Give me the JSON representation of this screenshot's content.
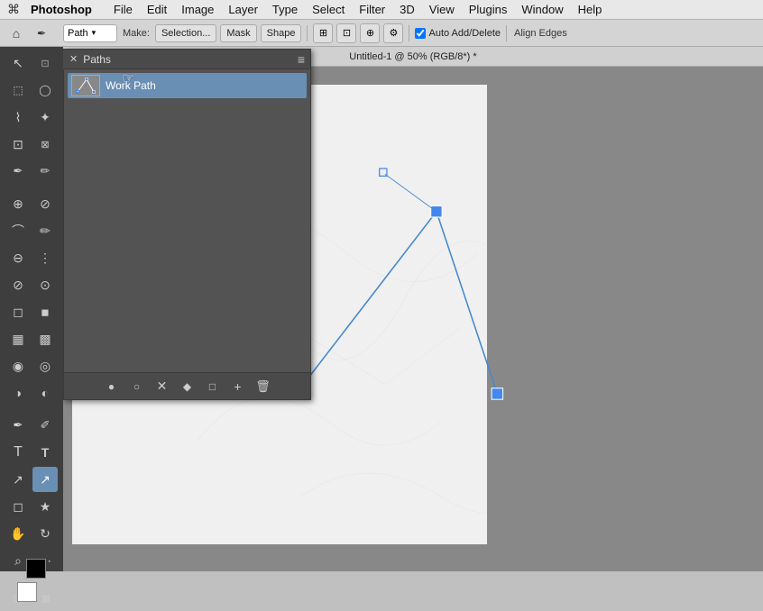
{
  "menubar": {
    "apple": "⌘",
    "appname": "Photoshop",
    "items": [
      "File",
      "Edit",
      "Image",
      "Layer",
      "Type",
      "Select",
      "Filter",
      "3D",
      "View",
      "Plugins",
      "Window",
      "Help"
    ]
  },
  "optionsbar": {
    "tool_icon": "pen",
    "path_dropdown": "Path",
    "make_label": "Make:",
    "selection_btn": "Selection...",
    "mask_btn": "Mask",
    "shape_btn": "Shape",
    "auto_add_delete": "Auto Add/Delete",
    "align_edges": "Align Edges"
  },
  "title": "Untitled-1 @ 50% (RGB/8*) *",
  "paths_panel": {
    "tab_label": "Paths",
    "work_path_label": "Work Path",
    "footer_icons": [
      "●",
      "○",
      "✕",
      "◆",
      "□",
      "+",
      "🗑"
    ]
  },
  "toolbar": {
    "tools": [
      {
        "name": "move",
        "icon": "↖"
      },
      {
        "name": "marquee-rect",
        "icon": "⬚"
      },
      {
        "name": "lasso",
        "icon": "○"
      },
      {
        "name": "magic-wand",
        "icon": "✦"
      },
      {
        "name": "crop",
        "icon": "⊡"
      },
      {
        "name": "eyedropper",
        "icon": "✒"
      },
      {
        "name": "healing",
        "icon": "⊕"
      },
      {
        "name": "brush",
        "icon": "⌒"
      },
      {
        "name": "clone",
        "icon": "⊖"
      },
      {
        "name": "history",
        "icon": "⊘"
      },
      {
        "name": "eraser",
        "icon": "◻"
      },
      {
        "name": "gradient",
        "icon": "▦"
      },
      {
        "name": "blur",
        "icon": "◉"
      },
      {
        "name": "dodge",
        "icon": "◑"
      },
      {
        "name": "pen",
        "icon": "✒"
      },
      {
        "name": "type",
        "icon": "T"
      },
      {
        "name": "path-selection",
        "icon": "↗"
      },
      {
        "name": "shape",
        "icon": "◻"
      },
      {
        "name": "hand",
        "icon": "✋"
      },
      {
        "name": "zoom",
        "icon": "⌕"
      },
      {
        "name": "3d-move",
        "icon": "⋯"
      }
    ]
  }
}
